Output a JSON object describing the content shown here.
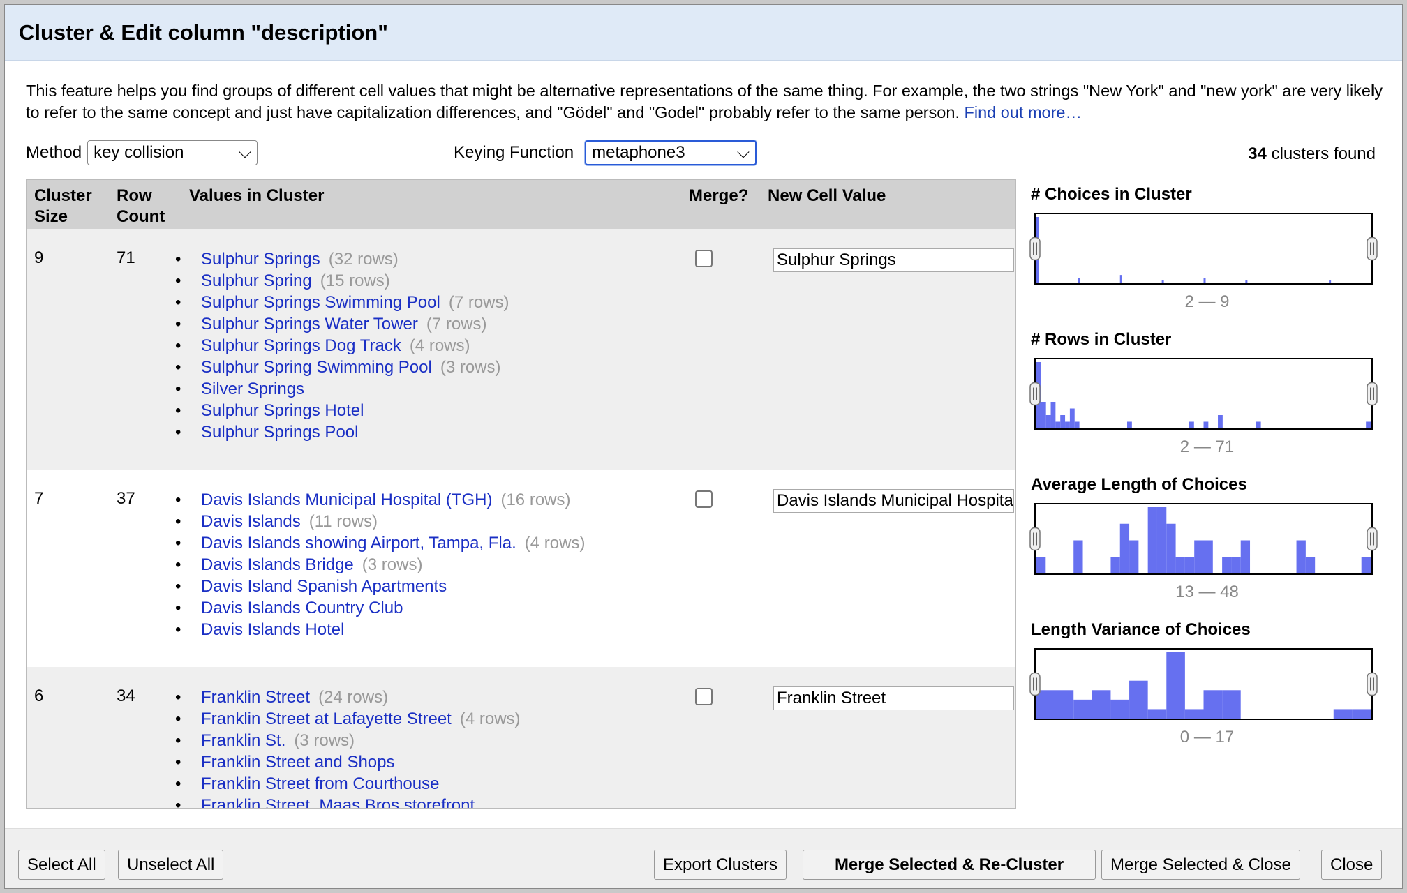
{
  "dialog": {
    "title": "Cluster & Edit column \"description\"",
    "description": "This feature helps you find groups of different cell values that might be alternative representations of the same thing. For example, the two strings \"New York\" and \"new york\" are very likely to refer to the same concept and just have capitalization differences, and \"Gödel\" and \"Godel\" probably refer to the same person.",
    "find_out_more": "Find out more…"
  },
  "controls": {
    "method_label": "Method",
    "method_value": "key collision",
    "keying_label": "Keying Function",
    "keying_value": "metaphone3",
    "clusters_count": "34",
    "clusters_suffix": "clusters found"
  },
  "table": {
    "headers": {
      "cluster_size": "Cluster Size",
      "row_count": "Row Count",
      "values": "Values in Cluster",
      "merge": "Merge?",
      "new_value": "New Cell Value"
    },
    "rows": [
      {
        "size": "9",
        "count": "71",
        "new_value": "Sulphur Springs",
        "merge": false,
        "values": [
          {
            "v": "Sulphur Springs",
            "rows": "(32 rows)"
          },
          {
            "v": "Sulphur Spring",
            "rows": "(15 rows)"
          },
          {
            "v": "Sulphur Springs Swimming Pool",
            "rows": "(7 rows)"
          },
          {
            "v": "Sulphur Springs Water Tower",
            "rows": "(7 rows)"
          },
          {
            "v": "Sulphur Springs Dog Track",
            "rows": "(4 rows)"
          },
          {
            "v": "Sulphur Spring Swimming Pool",
            "rows": "(3 rows)"
          },
          {
            "v": "Silver Springs",
            "rows": ""
          },
          {
            "v": "Sulphur Springs Hotel",
            "rows": ""
          },
          {
            "v": "Sulphur Springs Pool",
            "rows": ""
          }
        ]
      },
      {
        "size": "7",
        "count": "37",
        "new_value": "Davis Islands Municipal Hospital (TGH)",
        "merge": false,
        "values": [
          {
            "v": "Davis Islands Municipal Hospital (TGH)",
            "rows": "(16 rows)"
          },
          {
            "v": "Davis Islands",
            "rows": "(11 rows)"
          },
          {
            "v": "Davis Islands showing Airport, Tampa, Fla.",
            "rows": "(4 rows)"
          },
          {
            "v": "Davis Islands Bridge",
            "rows": "(3 rows)"
          },
          {
            "v": "Davis Island Spanish Apartments",
            "rows": ""
          },
          {
            "v": "Davis Islands Country Club",
            "rows": ""
          },
          {
            "v": "Davis Islands Hotel",
            "rows": ""
          }
        ]
      },
      {
        "size": "6",
        "count": "34",
        "new_value": "Franklin Street",
        "merge": false,
        "values": [
          {
            "v": "Franklin Street",
            "rows": "(24 rows)"
          },
          {
            "v": "Franklin Street at Lafayette Street",
            "rows": "(4 rows)"
          },
          {
            "v": "Franklin St.",
            "rows": "(3 rows)"
          },
          {
            "v": "Franklin Street and Shops",
            "rows": ""
          },
          {
            "v": "Franklin Street from Courthouse",
            "rows": ""
          },
          {
            "v": "Franklin Street, Maas Bros storefront",
            "rows": ""
          }
        ]
      }
    ]
  },
  "chart_data": [
    {
      "type": "bar",
      "title": "# Choices in Cluster",
      "range_label": "2 — 9",
      "bins": [
        24,
        2,
        3,
        1,
        2,
        1,
        0,
        1
      ],
      "color": "#6670f0"
    },
    {
      "type": "bar",
      "title": "# Rows in Cluster",
      "range_label": "2 — 71",
      "bins": [
        10,
        4,
        2,
        4,
        1,
        2,
        1,
        3,
        1,
        0,
        0,
        0,
        0,
        0,
        0,
        0,
        0,
        0,
        0,
        1,
        0,
        0,
        0,
        0,
        0,
        0,
        0,
        0,
        0,
        0,
        0,
        0,
        1,
        0,
        0,
        1,
        0,
        0,
        2,
        0,
        0,
        0,
        0,
        0,
        0,
        0,
        1,
        0,
        0,
        0,
        0,
        0,
        0,
        0,
        0,
        0,
        0,
        0,
        0,
        0,
        0,
        0,
        0,
        0,
        0,
        0,
        0,
        0,
        0,
        1
      ],
      "color": "#6670f0"
    },
    {
      "type": "bar",
      "title": "Average Length of Choices",
      "range_label": "13 — 48",
      "bins": [
        1,
        0,
        0,
        0,
        2,
        0,
        0,
        0,
        1,
        3,
        2,
        0,
        4,
        4,
        3,
        1,
        1,
        2,
        2,
        0,
        1,
        1,
        2,
        0,
        0,
        0,
        0,
        0,
        2,
        1,
        0,
        0,
        0,
        0,
        0,
        1
      ],
      "color": "#6670f0"
    },
    {
      "type": "bar",
      "title": "Length Variance of Choices",
      "range_label": "0 — 17",
      "bins": [
        3,
        3,
        2,
        3,
        2,
        4,
        1,
        7,
        1,
        3,
        3,
        0,
        0,
        0,
        0,
        0,
        1,
        1
      ],
      "color": "#6670f0"
    }
  ],
  "footer": {
    "select_all": "Select All",
    "unselect_all": "Unselect All",
    "export": "Export Clusters",
    "merge_recluster": "Merge Selected & Re-Cluster",
    "merge_close": "Merge Selected & Close",
    "close": "Close"
  }
}
